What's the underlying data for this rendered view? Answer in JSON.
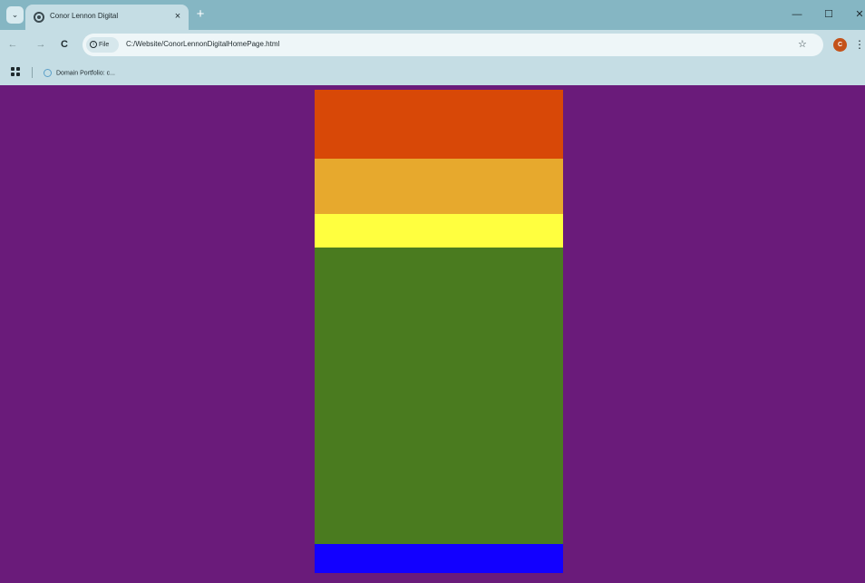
{
  "browser": {
    "tab_title": "Conor Lennon Digital",
    "tab_close_glyph": "×",
    "new_tab_glyph": "+",
    "tab_search_glyph": "⌄",
    "window_controls": {
      "minimize": "—",
      "maximize": "☐",
      "close": "✕"
    },
    "nav": {
      "back": "←",
      "forward": "→",
      "reload": "C"
    },
    "site_chip_label": "File",
    "url": "C:/Website/ConorLennonDigitalHomePage.html",
    "star_glyph": "☆",
    "profile_initial": "C",
    "menu_glyph": "⋮",
    "bookmark_label": "Domain Portfolio: c..."
  },
  "page": {
    "background_color": "#6a1b7a",
    "bands": [
      {
        "name": "band-orange",
        "color": "#d84807"
      },
      {
        "name": "band-gold",
        "color": "#e7a92d"
      },
      {
        "name": "band-yellow",
        "color": "#ffff3f"
      },
      {
        "name": "band-green",
        "color": "#4a7b1f"
      },
      {
        "name": "band-blue",
        "color": "#1200ff"
      }
    ]
  }
}
